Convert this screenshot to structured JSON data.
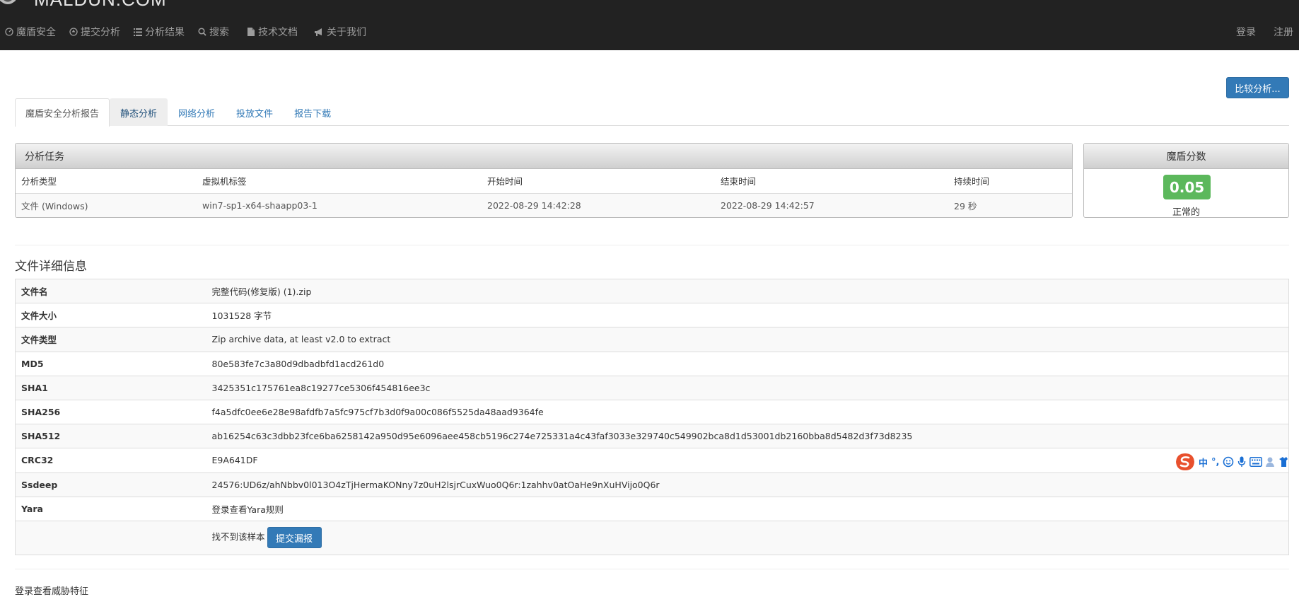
{
  "brand": {
    "name": "MALDUN.COM"
  },
  "nav": {
    "items": [
      {
        "label": "魔盾安全",
        "icon": "dashboard-icon"
      },
      {
        "label": "提交分析",
        "icon": "upload-circle-icon"
      },
      {
        "label": "分析结果",
        "icon": "list-icon"
      },
      {
        "label": "搜索",
        "icon": "search-icon"
      },
      {
        "label": "技术文档",
        "icon": "document-icon"
      },
      {
        "label": "关于我们",
        "icon": "bullhorn-icon"
      }
    ],
    "login": "登录",
    "register": "注册"
  },
  "compare_button": "比较分析...",
  "tabs": [
    {
      "label": "魔盾安全分析报告",
      "state": "active"
    },
    {
      "label": "静态分析",
      "state": "hover"
    },
    {
      "label": "网络分析",
      "state": "normal"
    },
    {
      "label": "投放文件",
      "state": "normal"
    },
    {
      "label": "报告下载",
      "state": "normal"
    }
  ],
  "task": {
    "title": "分析任务",
    "headers": [
      "分析类型",
      "虚拟机标签",
      "开始时间",
      "结束时间",
      "持续时间"
    ],
    "row": [
      "文件 (Windows)",
      "win7-sp1-x64-shaapp03-1",
      "2022-08-29 14:42:28",
      "2022-08-29 14:42:57",
      "29 秒"
    ]
  },
  "score": {
    "title": "魔盾分数",
    "value": "0.05",
    "label": "正常的",
    "color": "#5cb85c"
  },
  "file_details": {
    "title": "文件详细信息",
    "rows": [
      {
        "key": "文件名",
        "value": "完整代码(修复版) (1).zip"
      },
      {
        "key": "文件大小",
        "value": "1031528 字节"
      },
      {
        "key": "文件类型",
        "value": "Zip archive data, at least v2.0 to extract"
      },
      {
        "key": "MD5",
        "value": "80e583fe7c3a80d9dbadbfd1acd261d0"
      },
      {
        "key": "SHA1",
        "value": "3425351c175761ea8c19277ce5306f454816ee3c"
      },
      {
        "key": "SHA256",
        "value": "f4a5dfc0ee6e28e98afdfb7a5fc975cf7b3d0f9a00c086f5525da48aad9364fe"
      },
      {
        "key": "SHA512",
        "value": "ab16254c63c3dbb23fce6ba6258142a950d95e6096aee458cb5196c274e725331a4c43faf3033e329740c549902bca8d1d53001db2160bba8d5482d3f73d8235"
      },
      {
        "key": "CRC32",
        "value": "E9A641DF"
      },
      {
        "key": "Ssdeep",
        "value": "24576:UD6z/ahNbbv0l013O4zTjHermaKONny7z0uH2lsjrCuxWuo0Q6r:1zahhv0atOaHe9nXuHVijo0Q6r"
      },
      {
        "key": "Yara",
        "value": "登录查看Yara规则"
      }
    ],
    "not_found_text": "找不到该样本",
    "report_button": "提交漏报"
  },
  "login_threat": "登录查看威胁特征",
  "ime": {
    "lang": "中",
    "punct": "°,"
  }
}
